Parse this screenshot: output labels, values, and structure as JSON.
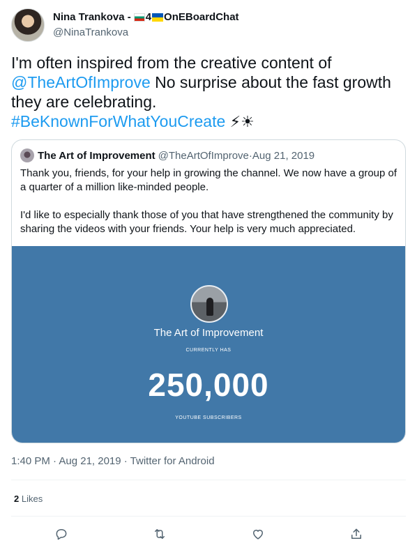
{
  "author": {
    "display_name_prefix": "Nina Trankova - ",
    "display_name_num": "4",
    "display_name_suffix": "OnEBoardChat",
    "handle": "@NinaTrankova"
  },
  "tweet": {
    "text_1": "I'm often inspired from the creative content of ",
    "mention": "@TheArtOfImprove",
    "text_2": "  No surprise about the fast growth they are celebrating.",
    "hashtag": "#BeKnownForWhatYouCreate",
    "emoji": "⚡☀"
  },
  "quote": {
    "name": "The Art of Improvement",
    "handle": "@TheArtOfImprove",
    "separator": " · ",
    "date": "Aug 21, 2019",
    "paragraph_1": "Thank you, friends, for your help in growing the channel. We now have a group of a quarter of a million like-minded people.",
    "paragraph_2": "I'd like to especially thank those of you that have strengthened the community by sharing the videos with your friends. Your help is very much appreciated.",
    "image": {
      "title": "The Art of Improvement",
      "currently_has": "CURRENTLY HAS",
      "count": "250,000",
      "subscribers": "YOUTUBE SUBSCRIBERS",
      "background": "#4178a8"
    }
  },
  "timestamp": "1:40 PM · Aug 21, 2019 · Twitter for Android",
  "likes": {
    "count": "2",
    "label": "Likes"
  },
  "actions": [
    "reply-icon",
    "retweet-icon",
    "like-icon",
    "share-icon"
  ],
  "colors": {
    "link": "#1d9bf0",
    "secondary": "#536471",
    "border": "#cfd9de"
  }
}
